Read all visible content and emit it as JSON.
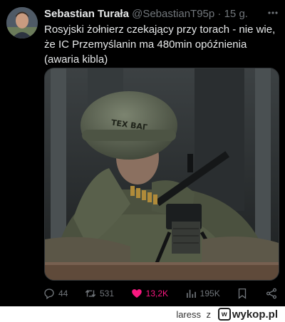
{
  "tweet": {
    "author_name": "Sebastian Turała",
    "handle": "@SebastianT95p",
    "separator": "·",
    "time": "15 g.",
    "more_icon": "more-dots-icon",
    "text": "Rosyjski żołnierz czekający przy torach - nie wie, że IC Przemyślanin ma 480min opóźnienia (awaria kibla)",
    "media": {
      "description_icon": "photo",
      "helmet_text": "ТЕХ ВАГ"
    }
  },
  "actions": {
    "reply_count": "44",
    "retweet_count": "531",
    "like_count": "13,2K",
    "view_count": "195K",
    "like_color": "#f91880",
    "icons": [
      "reply-icon",
      "retweet-icon",
      "heart-icon",
      "views-icon",
      "bookmark-icon",
      "share-icon"
    ]
  },
  "footer": {
    "username": "laress",
    "connector": "z",
    "brand": "wykop.pl"
  }
}
